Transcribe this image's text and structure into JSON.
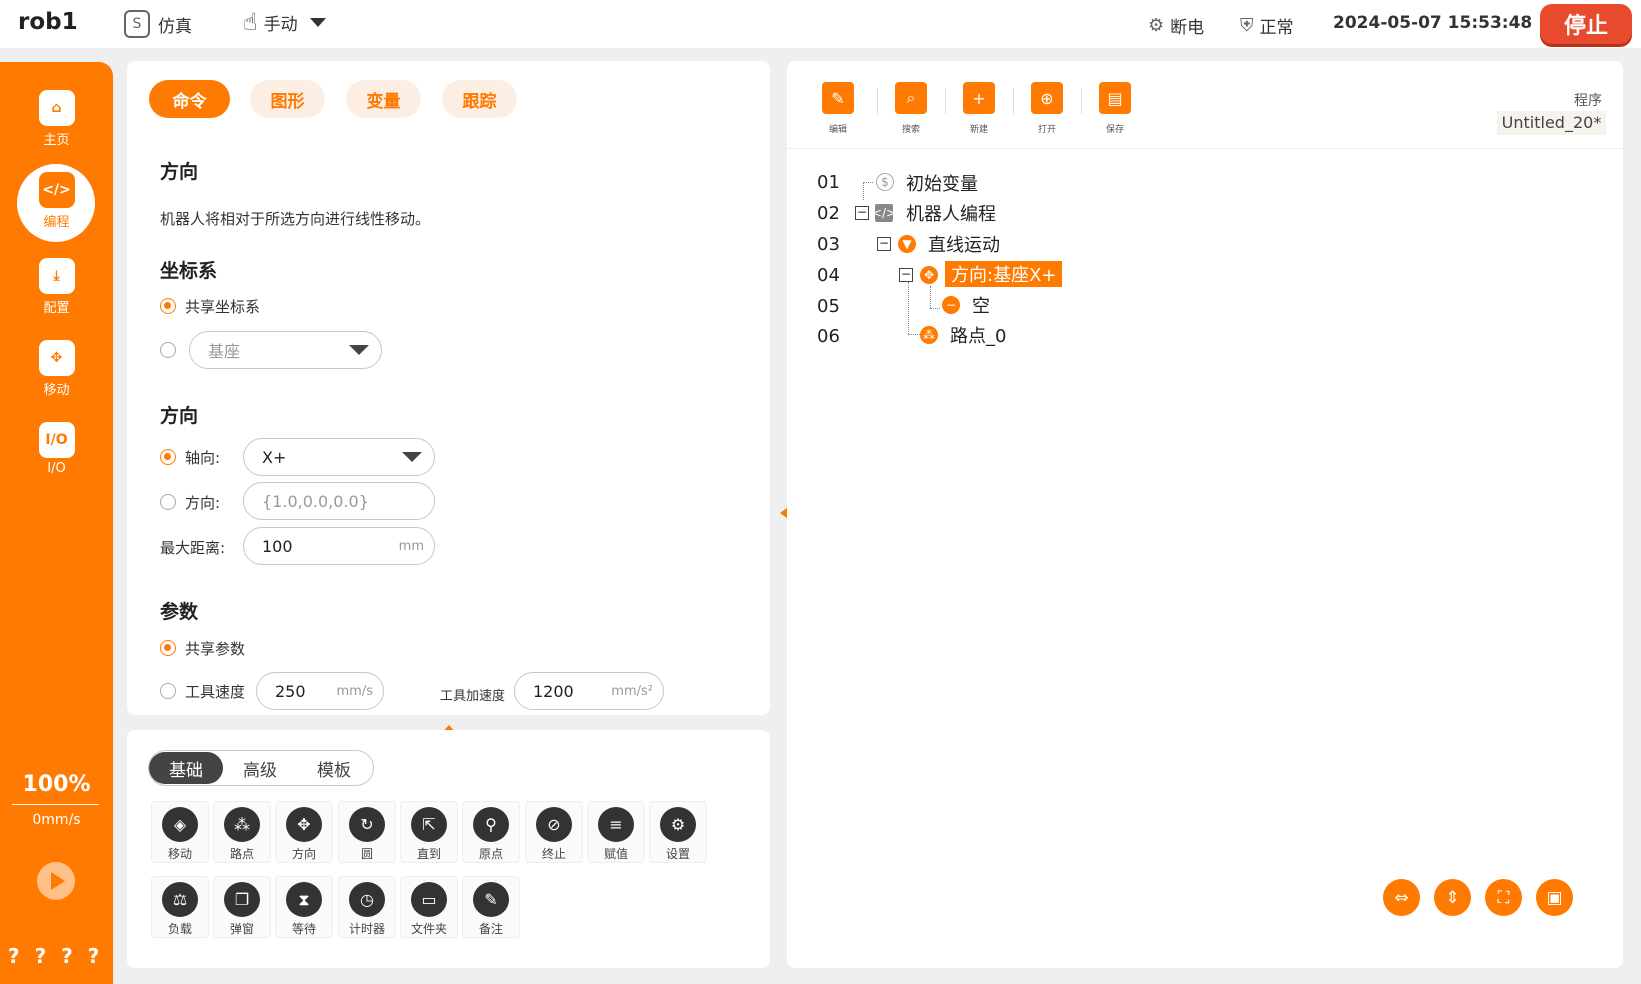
{
  "topbar": {
    "robot_name": "rob1",
    "sim_label": "仿真",
    "mode_label": "手动",
    "power_label": "断电",
    "status_label": "正常",
    "datetime": "2024-05-07 15:53:48",
    "stop_label": "停止"
  },
  "sidebar": {
    "items": [
      {
        "label": "主页",
        "icon": "home-icon"
      },
      {
        "label": "编程",
        "icon": "code-icon"
      },
      {
        "label": "配置",
        "icon": "download-icon"
      },
      {
        "label": "移动",
        "icon": "move-icon"
      },
      {
        "label": "I/O",
        "icon": "io-icon"
      }
    ],
    "speed_percent": "100%",
    "speed_value": "0mm/s",
    "help_text": "? ? ? ?"
  },
  "command_panel": {
    "tabs": [
      "命令",
      "图形",
      "变量",
      "跟踪"
    ],
    "title": "方向",
    "description": "机器人将相对于所选方向进行线性移动。",
    "coord_section": "坐标系",
    "coord_shared": "共享坐标系",
    "coord_select_value": "基座",
    "direction_section": "方向",
    "axis_label": "轴向:",
    "axis_value": "X+",
    "dir_label": "方向:",
    "dir_placeholder": "{1.0,0.0,0.0}",
    "max_dist_label": "最大距离:",
    "max_dist_value": "100",
    "max_dist_unit": "mm",
    "params_section": "参数",
    "params_shared": "共享参数",
    "tool_speed_label": "工具速度",
    "tool_speed_value": "250",
    "tool_speed_unit": "mm/s",
    "tool_accel_label": "工具加速度",
    "tool_accel_value": "1200",
    "tool_accel_unit": "mm/s²"
  },
  "palette": {
    "segments": [
      "基础",
      "高级",
      "模板"
    ],
    "row1": [
      "移动",
      "路点",
      "方向",
      "圆",
      "直到",
      "原点",
      "终止",
      "赋值",
      "设置"
    ],
    "row2": [
      "负载",
      "弹窗",
      "等待",
      "计时器",
      "文件夹",
      "备注"
    ]
  },
  "program_panel": {
    "toolbar": [
      "编辑",
      "搜索",
      "新建",
      "打开",
      "保存"
    ],
    "program_label": "程序",
    "program_name": "Untitled_20*",
    "line_numbers": [
      "01",
      "02",
      "03",
      "04",
      "05",
      "06"
    ],
    "nodes": [
      "初始变量",
      "机器人编程",
      "直线运动",
      "方向:基座X+",
      "空",
      "路点_0"
    ]
  },
  "colors": {
    "accent": "#ff7a00",
    "stop": "#e84a2e"
  }
}
